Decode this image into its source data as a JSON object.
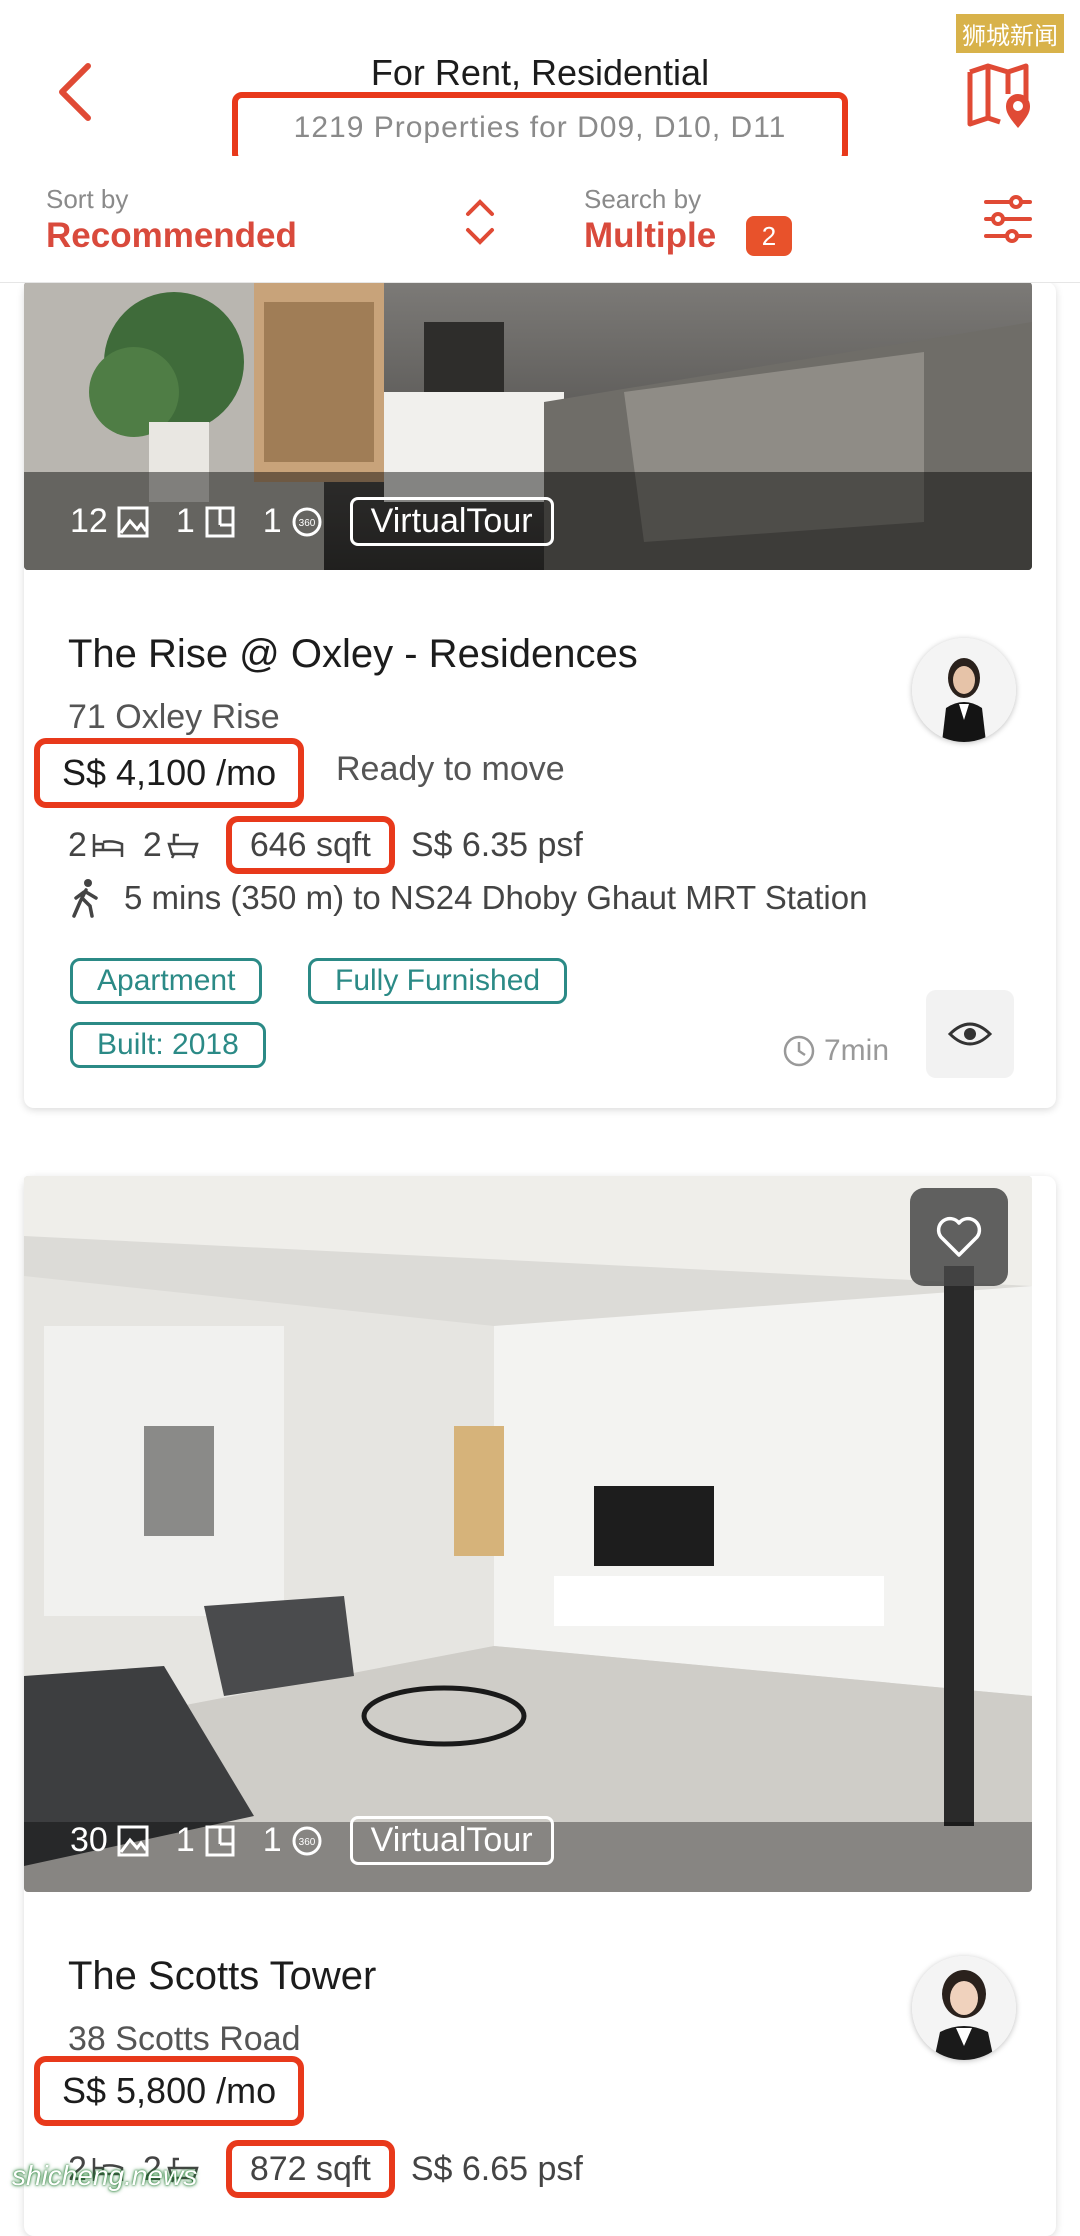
{
  "watermarks": {
    "top": "狮城新闻",
    "bottom": "shicheng.news"
  },
  "header": {
    "title": "For Rent, Residential",
    "subtitle": "1219 Properties for D09, D10, D11"
  },
  "sortbar": {
    "sort_label": "Sort by",
    "sort_value": "Recommended",
    "search_label": "Search by",
    "search_value": "Multiple",
    "search_badge": "2"
  },
  "listings": [
    {
      "photos_count": "12",
      "floorplans_count": "1",
      "tours_count": "1",
      "virtual_tour": "VirtualTour",
      "title": "The Rise @ Oxley - Residences",
      "address": "71 Oxley Rise",
      "price": "S$ 4,100 /mo",
      "availability": "Ready to move",
      "beds": "2",
      "baths": "2",
      "size": "646 sqft",
      "psf": "S$ 6.35 psf",
      "mrt": "5 mins (350 m) to NS24 Dhoby Ghaut MRT Station",
      "tags": [
        "Apartment",
        "Fully Furnished",
        "Built: 2018"
      ],
      "time": "7min"
    },
    {
      "photos_count": "30",
      "floorplans_count": "1",
      "tours_count": "1",
      "virtual_tour": "VirtualTour",
      "title": "The Scotts Tower",
      "address": "38 Scotts Road",
      "price": "S$ 5,800 /mo",
      "beds": "2",
      "baths": "2",
      "size": "872 sqft",
      "psf": "S$ 6.65 psf"
    }
  ],
  "colors": {
    "accent": "#d94a3c",
    "highlight": "#e8391b",
    "tag": "#2b8a86"
  }
}
